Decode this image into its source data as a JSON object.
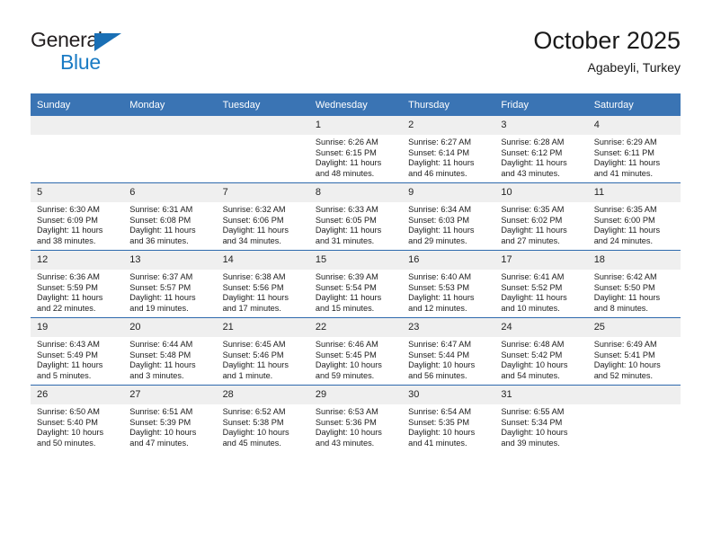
{
  "brand": {
    "line1": "General",
    "line2": "Blue",
    "triangle_color": "#1a6fb5"
  },
  "header": {
    "title": "October 2025",
    "subtitle": "Agabeyli, Turkey"
  },
  "colors": {
    "header_bg": "#3a74b4",
    "daynum_bg": "#efefef",
    "row_divider": "#2e6aad",
    "brand_blue": "#1a7bc4"
  },
  "weekdays": [
    "Sunday",
    "Monday",
    "Tuesday",
    "Wednesday",
    "Thursday",
    "Friday",
    "Saturday"
  ],
  "labels": {
    "sunrise": "Sunrise:",
    "sunset": "Sunset:",
    "daylight": "Daylight:"
  },
  "weeks": [
    [
      {
        "day": "",
        "empty": true
      },
      {
        "day": "",
        "empty": true
      },
      {
        "day": "",
        "empty": true
      },
      {
        "day": "1",
        "sunrise": "Sunrise: 6:26 AM",
        "sunset": "Sunset: 6:15 PM",
        "daylight": "Daylight: 11 hours and 48 minutes."
      },
      {
        "day": "2",
        "sunrise": "Sunrise: 6:27 AM",
        "sunset": "Sunset: 6:14 PM",
        "daylight": "Daylight: 11 hours and 46 minutes."
      },
      {
        "day": "3",
        "sunrise": "Sunrise: 6:28 AM",
        "sunset": "Sunset: 6:12 PM",
        "daylight": "Daylight: 11 hours and 43 minutes."
      },
      {
        "day": "4",
        "sunrise": "Sunrise: 6:29 AM",
        "sunset": "Sunset: 6:11 PM",
        "daylight": "Daylight: 11 hours and 41 minutes."
      }
    ],
    [
      {
        "day": "5",
        "sunrise": "Sunrise: 6:30 AM",
        "sunset": "Sunset: 6:09 PM",
        "daylight": "Daylight: 11 hours and 38 minutes."
      },
      {
        "day": "6",
        "sunrise": "Sunrise: 6:31 AM",
        "sunset": "Sunset: 6:08 PM",
        "daylight": "Daylight: 11 hours and 36 minutes."
      },
      {
        "day": "7",
        "sunrise": "Sunrise: 6:32 AM",
        "sunset": "Sunset: 6:06 PM",
        "daylight": "Daylight: 11 hours and 34 minutes."
      },
      {
        "day": "8",
        "sunrise": "Sunrise: 6:33 AM",
        "sunset": "Sunset: 6:05 PM",
        "daylight": "Daylight: 11 hours and 31 minutes."
      },
      {
        "day": "9",
        "sunrise": "Sunrise: 6:34 AM",
        "sunset": "Sunset: 6:03 PM",
        "daylight": "Daylight: 11 hours and 29 minutes."
      },
      {
        "day": "10",
        "sunrise": "Sunrise: 6:35 AM",
        "sunset": "Sunset: 6:02 PM",
        "daylight": "Daylight: 11 hours and 27 minutes."
      },
      {
        "day": "11",
        "sunrise": "Sunrise: 6:35 AM",
        "sunset": "Sunset: 6:00 PM",
        "daylight": "Daylight: 11 hours and 24 minutes."
      }
    ],
    [
      {
        "day": "12",
        "sunrise": "Sunrise: 6:36 AM",
        "sunset": "Sunset: 5:59 PM",
        "daylight": "Daylight: 11 hours and 22 minutes."
      },
      {
        "day": "13",
        "sunrise": "Sunrise: 6:37 AM",
        "sunset": "Sunset: 5:57 PM",
        "daylight": "Daylight: 11 hours and 19 minutes."
      },
      {
        "day": "14",
        "sunrise": "Sunrise: 6:38 AM",
        "sunset": "Sunset: 5:56 PM",
        "daylight": "Daylight: 11 hours and 17 minutes."
      },
      {
        "day": "15",
        "sunrise": "Sunrise: 6:39 AM",
        "sunset": "Sunset: 5:54 PM",
        "daylight": "Daylight: 11 hours and 15 minutes."
      },
      {
        "day": "16",
        "sunrise": "Sunrise: 6:40 AM",
        "sunset": "Sunset: 5:53 PM",
        "daylight": "Daylight: 11 hours and 12 minutes."
      },
      {
        "day": "17",
        "sunrise": "Sunrise: 6:41 AM",
        "sunset": "Sunset: 5:52 PM",
        "daylight": "Daylight: 11 hours and 10 minutes."
      },
      {
        "day": "18",
        "sunrise": "Sunrise: 6:42 AM",
        "sunset": "Sunset: 5:50 PM",
        "daylight": "Daylight: 11 hours and 8 minutes."
      }
    ],
    [
      {
        "day": "19",
        "sunrise": "Sunrise: 6:43 AM",
        "sunset": "Sunset: 5:49 PM",
        "daylight": "Daylight: 11 hours and 5 minutes."
      },
      {
        "day": "20",
        "sunrise": "Sunrise: 6:44 AM",
        "sunset": "Sunset: 5:48 PM",
        "daylight": "Daylight: 11 hours and 3 minutes."
      },
      {
        "day": "21",
        "sunrise": "Sunrise: 6:45 AM",
        "sunset": "Sunset: 5:46 PM",
        "daylight": "Daylight: 11 hours and 1 minute."
      },
      {
        "day": "22",
        "sunrise": "Sunrise: 6:46 AM",
        "sunset": "Sunset: 5:45 PM",
        "daylight": "Daylight: 10 hours and 59 minutes."
      },
      {
        "day": "23",
        "sunrise": "Sunrise: 6:47 AM",
        "sunset": "Sunset: 5:44 PM",
        "daylight": "Daylight: 10 hours and 56 minutes."
      },
      {
        "day": "24",
        "sunrise": "Sunrise: 6:48 AM",
        "sunset": "Sunset: 5:42 PM",
        "daylight": "Daylight: 10 hours and 54 minutes."
      },
      {
        "day": "25",
        "sunrise": "Sunrise: 6:49 AM",
        "sunset": "Sunset: 5:41 PM",
        "daylight": "Daylight: 10 hours and 52 minutes."
      }
    ],
    [
      {
        "day": "26",
        "sunrise": "Sunrise: 6:50 AM",
        "sunset": "Sunset: 5:40 PM",
        "daylight": "Daylight: 10 hours and 50 minutes."
      },
      {
        "day": "27",
        "sunrise": "Sunrise: 6:51 AM",
        "sunset": "Sunset: 5:39 PM",
        "daylight": "Daylight: 10 hours and 47 minutes."
      },
      {
        "day": "28",
        "sunrise": "Sunrise: 6:52 AM",
        "sunset": "Sunset: 5:38 PM",
        "daylight": "Daylight: 10 hours and 45 minutes."
      },
      {
        "day": "29",
        "sunrise": "Sunrise: 6:53 AM",
        "sunset": "Sunset: 5:36 PM",
        "daylight": "Daylight: 10 hours and 43 minutes."
      },
      {
        "day": "30",
        "sunrise": "Sunrise: 6:54 AM",
        "sunset": "Sunset: 5:35 PM",
        "daylight": "Daylight: 10 hours and 41 minutes."
      },
      {
        "day": "31",
        "sunrise": "Sunrise: 6:55 AM",
        "sunset": "Sunset: 5:34 PM",
        "daylight": "Daylight: 10 hours and 39 minutes."
      },
      {
        "day": "",
        "empty": true
      }
    ]
  ]
}
